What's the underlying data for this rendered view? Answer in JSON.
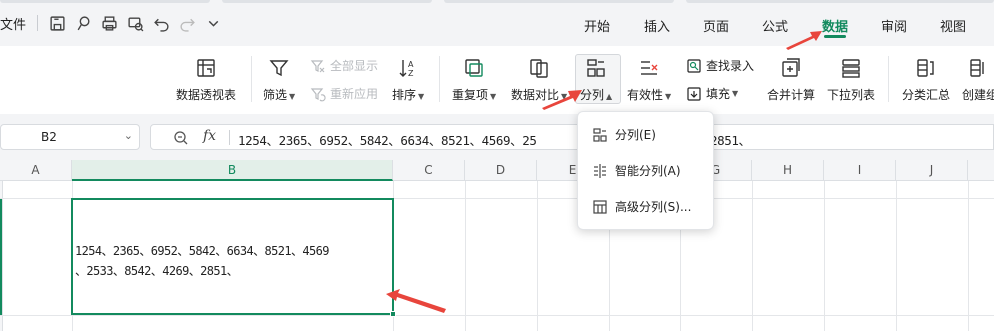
{
  "menubar": {
    "file_label": "文件",
    "tabs": [
      "开始",
      "插入",
      "页面",
      "公式",
      "数据",
      "审阅",
      "视图"
    ],
    "active_tab": "数据"
  },
  "ribbon": {
    "pivot_table": "数据透视表",
    "filter": "筛选",
    "show_all": "全部显示",
    "reapply": "重新应用",
    "sort": "排序",
    "duplicates": "重复项",
    "data_compare": "数据对比",
    "split_column": "分列",
    "validity": "有效性",
    "find_entry": "查找录入",
    "fill": "填充",
    "consolidate": "合并计算",
    "dropdown_list": "下拉列表",
    "subtotal": "分类汇总",
    "create_group": "创建组"
  },
  "formula_bar": {
    "name_box": "B2",
    "fx_label": "fx",
    "value": "1254、2365、6952、5842、6634、8521、4569、25",
    "value_tail": "2851、"
  },
  "grid": {
    "columns": [
      "A",
      "B",
      "C",
      "D",
      "E",
      "F",
      "G",
      "H",
      "I",
      "J"
    ],
    "selected_column": "B",
    "cell_b2_line1": "1254、2365、6952、5842、6634、8521、4569",
    "cell_b2_line2": "、2533、8542、4269、2851、"
  },
  "dropdown": {
    "items": [
      "分列(E)",
      "智能分列(A)",
      "高级分列(S)..."
    ]
  },
  "colors": {
    "accent": "#138a5e",
    "arrow": "#e8453c"
  }
}
